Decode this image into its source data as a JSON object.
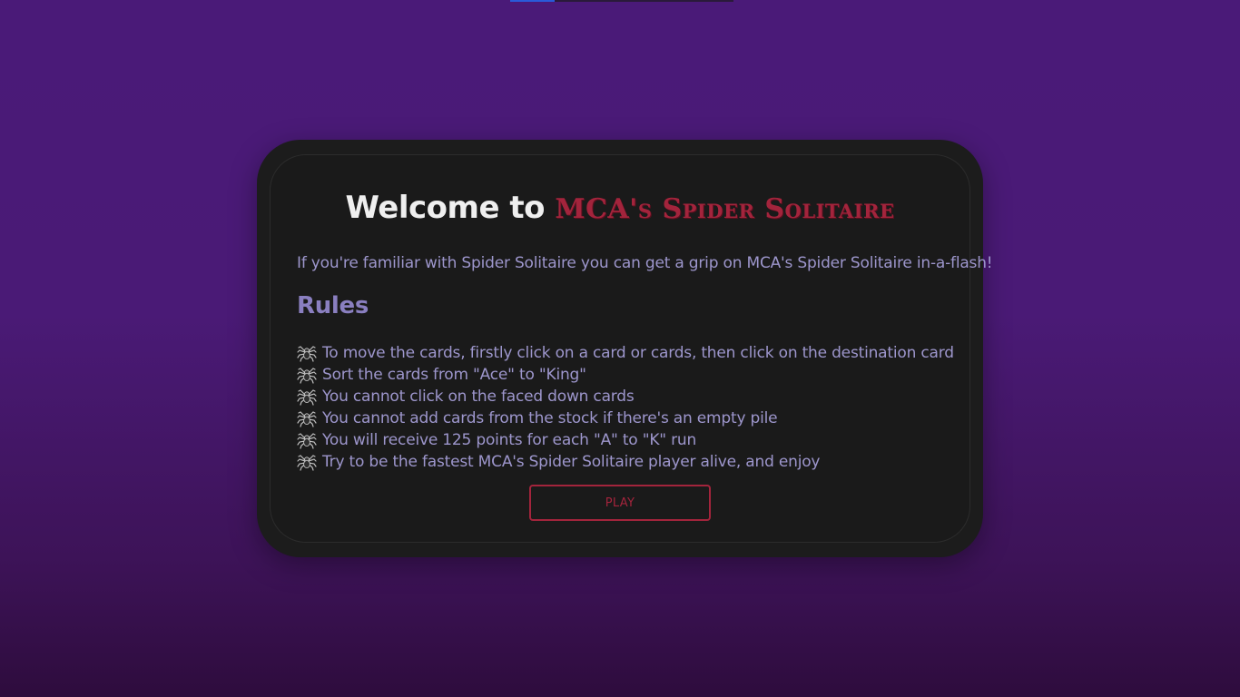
{
  "top_progress": {
    "fill_fraction": 0.2
  },
  "welcome": {
    "title_prefix": "Welcome to",
    "brand_name": "MCA's Spider Solitaire",
    "intro": "If you're familiar with Spider Solitaire you can get a grip on MCA's Spider Solitaire in-a-flash!"
  },
  "rules": {
    "heading": "Rules",
    "icon": "spider-icon",
    "items": [
      "To move the cards, firstly click on a card or cards, then click on the destination card",
      "Sort the cards from \"Ace\" to \"King\"",
      "You cannot click on the faced down cards",
      "You cannot add cards from the stock if there's an empty pile",
      "You will receive 125 points for each \"A\" to \"K\" run",
      "Try to be the fastest MCA's Spider Solitaire player alive, and enjoy"
    ]
  },
  "play_button": {
    "label": "PLAY"
  },
  "colors": {
    "accent": "#a3243c",
    "text": "#9d96cc",
    "heading": "#8a7fc0",
    "card": "#1a1a1a"
  }
}
